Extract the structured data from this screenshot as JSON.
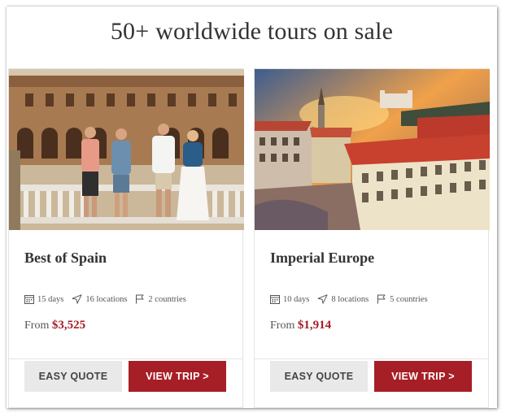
{
  "headline": "50+ worldwide tours on sale",
  "colors": {
    "accent": "#a61e26",
    "button_gray": "#e9e9e9",
    "text": "#333333"
  },
  "icons": {
    "days": "calendar-icon",
    "locations": "navigation-arrow-icon",
    "countries": "flag-icon"
  },
  "tours": [
    {
      "image": "photo of four travelers posing at a balustrade in front of a Spanish plaza",
      "title": "Best of Spain",
      "days": "15 days",
      "locations": "16 locations",
      "countries": "2 countries",
      "price_prefix": "From",
      "price": "$3,525",
      "quote_label": "EASY QUOTE",
      "view_label": "VIEW TRIP >"
    },
    {
      "image": "photo of red-roofed old town and castle at sunset",
      "title": "Imperial Europe",
      "days": "10 days",
      "locations": "8 locations",
      "countries": "5 countries",
      "price_prefix": "From",
      "price": "$1,914",
      "quote_label": "EASY QUOTE",
      "view_label": "VIEW TRIP >"
    }
  ]
}
